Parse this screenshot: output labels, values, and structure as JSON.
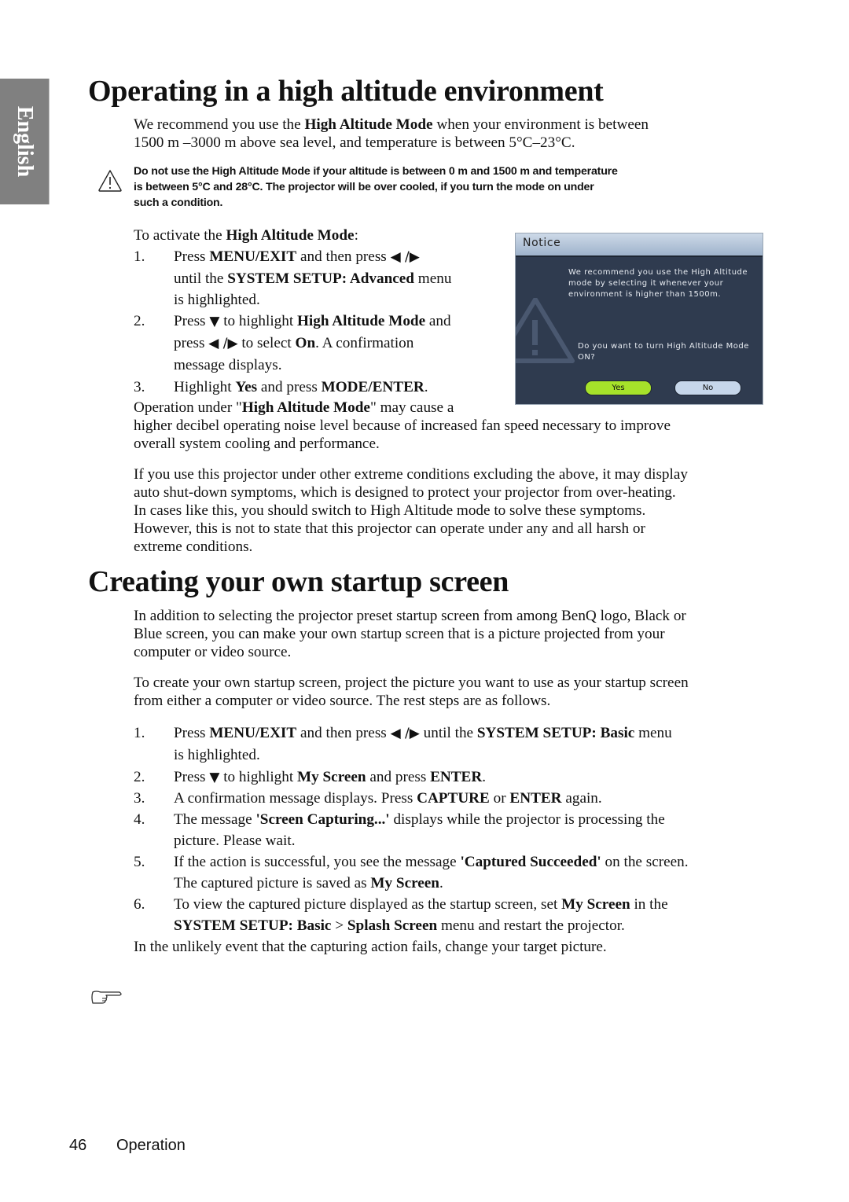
{
  "side_tab": {
    "label": "English"
  },
  "section1": {
    "title": "Operating in a high altitude environment",
    "intro": [
      [
        {
          "t": "We recommend you use the "
        },
        {
          "t": "High Altitude Mode",
          "b": true
        },
        {
          "t": " when your environment is between"
        }
      ],
      [
        {
          "t": "1500 m –3000 m above sea level, and temperature is between 5°C–23°C."
        }
      ]
    ],
    "warning": {
      "icon": "warning-triangle-icon",
      "lines": [
        "Do not use the High Altitude Mode if your altitude is between 0 m and 1500 m and temperature",
        "is between 5°C and 28°C. The projector will be over cooled, if you turn the mode on under",
        "such a condition."
      ]
    },
    "activate_heading": [
      {
        "t": "To activate the "
      },
      {
        "t": "High Altitude Mode",
        "b": true
      },
      {
        "t": ":"
      }
    ],
    "steps": [
      {
        "num": "1.",
        "lines": [
          [
            {
              "t": "Press "
            },
            {
              "t": "MENU/EXIT",
              "b": true
            },
            {
              "t": " and then press "
            },
            {
              "t": "◀ /▶",
              "a": true
            }
          ],
          [
            {
              "t": "until the "
            },
            {
              "t": "SYSTEM SETUP: Advanced",
              "b": true
            },
            {
              "t": " menu"
            }
          ],
          [
            {
              "t": "is highlighted."
            }
          ]
        ]
      },
      {
        "num": "2.",
        "lines": [
          [
            {
              "t": "Press "
            },
            {
              "t": "▼",
              "a": true
            },
            {
              "t": "  to highlight "
            },
            {
              "t": "High Altitude Mode",
              "b": true
            },
            {
              "t": " and"
            }
          ],
          [
            {
              "t": "press "
            },
            {
              "t": "◀ /▶",
              "a": true
            },
            {
              "t": "  to select "
            },
            {
              "t": "On",
              "b": true
            },
            {
              "t": ". A confirmation"
            }
          ],
          [
            {
              "t": "message displays."
            }
          ]
        ]
      },
      {
        "num": "3.",
        "lines": [
          [
            {
              "t": "Highlight "
            },
            {
              "t": "Yes",
              "b": true
            },
            {
              "t": " and press "
            },
            {
              "t": "MODE/ENTER",
              "b": true
            },
            {
              "t": "."
            }
          ]
        ]
      }
    ],
    "operation_note": [
      [
        {
          "t": "Operation under \""
        },
        {
          "t": "High Altitude Mode",
          "b": true
        },
        {
          "t": "\" may cause a"
        }
      ],
      [
        {
          "t": "higher decibel operating noise level because of increased fan speed necessary to improve"
        }
      ],
      [
        {
          "t": "overall system cooling and performance."
        }
      ]
    ],
    "extreme_conditions": [
      "If you use this projector under other extreme conditions excluding the above, it may display",
      "auto shut-down symptoms, which is designed to protect your projector from over-heating.",
      "In cases like this, you should switch to High Altitude mode to solve these symptoms.",
      "However, this is not to state that this projector can operate under any and all harsh or",
      "extreme conditions."
    ],
    "notice_dialog": {
      "title": "Notice",
      "message": "We recommend you use the High Altitude mode by selecting it whenever your environment is higher than 1500m.",
      "question": "Do you want to turn High Altitude Mode ON?",
      "yes_label": "Yes",
      "no_label": "No",
      "colors": {
        "body": "#2f3b4f",
        "yes": "#a6e22a",
        "no": "#c6d6ea"
      }
    }
  },
  "section2": {
    "title": "Creating your own startup screen",
    "para1": [
      "In addition to selecting the projector preset startup screen from among BenQ logo, Black or",
      "Blue screen, you can make your own startup screen that is a picture projected from your",
      "computer or video source."
    ],
    "para2": [
      "To create your own startup screen, project the picture you want to use as your startup screen",
      "from either a computer or video source. The rest steps are as follows."
    ],
    "steps": [
      {
        "num": "1.",
        "lines": [
          [
            {
              "t": "Press "
            },
            {
              "t": "MENU/EXIT",
              "b": true
            },
            {
              "t": " and then press "
            },
            {
              "t": "◀ /▶",
              "a": true
            },
            {
              "t": "  until the "
            },
            {
              "t": "SYSTEM SETUP: Basic",
              "b": true
            },
            {
              "t": " menu"
            }
          ],
          [
            {
              "t": "is highlighted."
            }
          ]
        ]
      },
      {
        "num": "2.",
        "lines": [
          [
            {
              "t": "Press "
            },
            {
              "t": "▼",
              "a": true
            },
            {
              "t": "  to highlight "
            },
            {
              "t": "My Screen",
              "b": true
            },
            {
              "t": " and press "
            },
            {
              "t": "ENTER",
              "b": true
            },
            {
              "t": "."
            }
          ]
        ]
      },
      {
        "num": "3.",
        "lines": [
          [
            {
              "t": "A confirmation message displays. Press "
            },
            {
              "t": "CAPTURE",
              "b": true
            },
            {
              "t": " or "
            },
            {
              "t": "ENTER",
              "b": true
            },
            {
              "t": " again."
            }
          ]
        ]
      },
      {
        "num": "4.",
        "lines": [
          [
            {
              "t": "The message "
            },
            {
              "t": "'Screen Capturing...'",
              "b": true
            },
            {
              "t": " displays while the projector is processing the"
            }
          ],
          [
            {
              "t": "picture. Please wait."
            }
          ]
        ]
      },
      {
        "num": "5.",
        "lines": [
          [
            {
              "t": "If the action is successful, you see the message "
            },
            {
              "t": "'Captured Succeeded'",
              "b": true
            },
            {
              "t": " on the screen."
            }
          ],
          [
            {
              "t": "The captured picture is saved as "
            },
            {
              "t": "My Screen",
              "b": true
            },
            {
              "t": "."
            }
          ]
        ]
      },
      {
        "num": "6.",
        "lines": [
          [
            {
              "t": "To view the captured picture displayed as the startup screen, set "
            },
            {
              "t": "My Screen",
              "b": true
            },
            {
              "t": " in the"
            }
          ],
          [
            {
              "t": "SYSTEM SETUP: Basic",
              "b": true
            },
            {
              "t": " > "
            },
            {
              "t": "Splash Screen",
              "b": true
            },
            {
              "t": " menu and restart the projector."
            }
          ]
        ]
      }
    ],
    "closing": "In the unlikely event that the capturing action fails, change your target picture.",
    "note_icon": "pointing-hand-icon"
  },
  "footer": {
    "page_number": "46",
    "section": "Operation"
  }
}
